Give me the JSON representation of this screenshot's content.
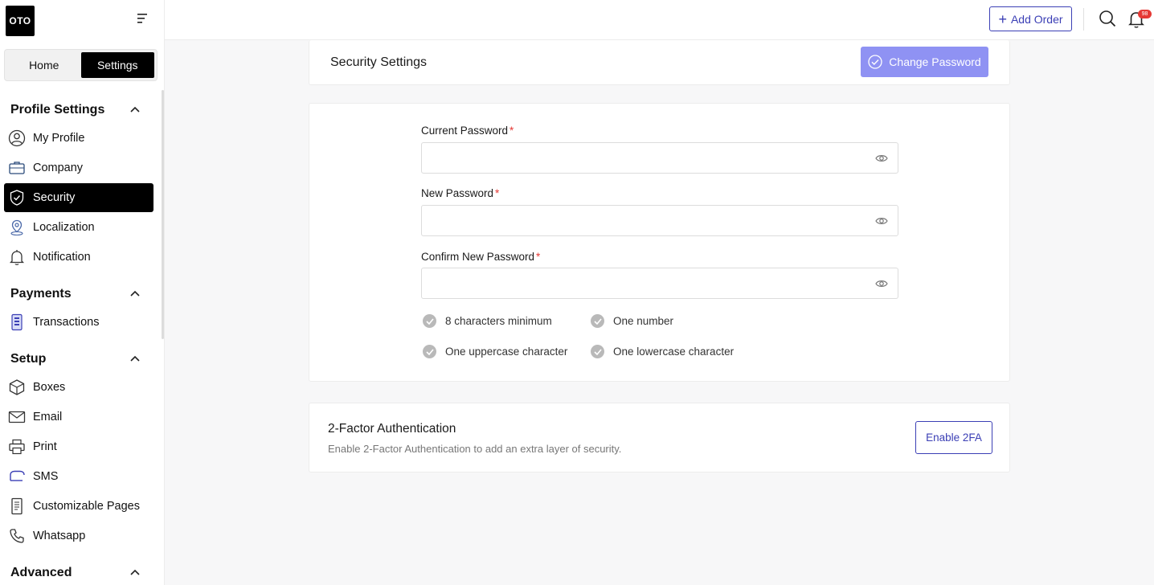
{
  "brand": {
    "logo_text": "OTO"
  },
  "sidebar": {
    "segments": [
      {
        "label": "Home"
      },
      {
        "label": "Settings",
        "active": true
      }
    ],
    "sections": [
      {
        "title": "Profile Settings",
        "items": [
          {
            "label": "My Profile",
            "icon": "user-circle-icon"
          },
          {
            "label": "Company",
            "icon": "briefcase-icon"
          },
          {
            "label": "Security",
            "icon": "shield-check-icon",
            "active": true
          },
          {
            "label": "Localization",
            "icon": "map-pin-icon"
          },
          {
            "label": "Notification",
            "icon": "bell-icon"
          }
        ]
      },
      {
        "title": "Payments",
        "items": [
          {
            "label": "Transactions",
            "icon": "receipt-icon"
          }
        ]
      },
      {
        "title": "Setup",
        "items": [
          {
            "label": "Boxes",
            "icon": "box-icon"
          },
          {
            "label": "Email",
            "icon": "mail-icon"
          },
          {
            "label": "Print",
            "icon": "printer-icon"
          },
          {
            "label": "SMS",
            "icon": "sms-icon"
          },
          {
            "label": "Customizable Pages",
            "icon": "document-icon"
          },
          {
            "label": "Whatsapp",
            "icon": "phone-icon"
          }
        ]
      },
      {
        "title": "Advanced",
        "items": []
      }
    ]
  },
  "topbar": {
    "add_order_label": "Add Order",
    "notification_count": "98"
  },
  "security": {
    "title": "Security Settings",
    "change_password_label": "Change Password",
    "fields": [
      {
        "label": "Current Password",
        "required_mark": "*",
        "value": ""
      },
      {
        "label": "New Password",
        "required_mark": "*",
        "value": ""
      },
      {
        "label": "Confirm New Password",
        "required_mark": "*",
        "value": ""
      }
    ],
    "rules": [
      "8 characters minimum",
      "One number",
      "One uppercase character",
      "One lowercase character"
    ]
  },
  "two_factor": {
    "title": "2-Factor Authentication",
    "description": "Enable 2-Factor Authentication to add an extra layer of security.",
    "button_label": "Enable 2FA"
  },
  "colors": {
    "accent": "#3b3fb5",
    "primary_disabled": "#8f92f3",
    "active_nav": "#000000",
    "required": "#e53935"
  }
}
